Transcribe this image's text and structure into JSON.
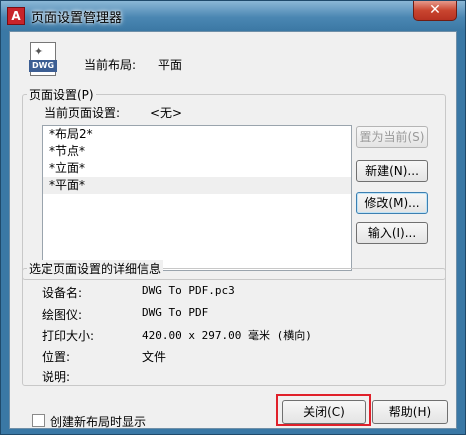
{
  "window": {
    "title": "页面设置管理器",
    "app_icon_letter": "A",
    "close_glyph": "✕"
  },
  "header": {
    "icon_label": "DWG",
    "current_layout_label": "当前布局:",
    "current_layout_value": "平面"
  },
  "page_setup": {
    "group_title": "页面设置(P)",
    "current_label": "当前页面设置:",
    "current_value": "<无>",
    "items": [
      "*布局2*",
      "*节点*",
      "*立面*",
      "*平面*"
    ],
    "selected_index": 3,
    "buttons": {
      "set_current": "置为当前(S)",
      "new": "新建(N)...",
      "modify": "修改(M)...",
      "import": "输入(I)..."
    }
  },
  "details": {
    "group_title": "选定页面设置的详细信息",
    "device_label": "设备名:",
    "device_value": "DWG To PDF.pc3",
    "plotter_label": "绘图仪:",
    "plotter_value": "DWG To PDF",
    "size_label": "打印大小:",
    "size_value": "420.00 x 297.00 毫米 (横向)",
    "location_label": "位置:",
    "location_value": "文件",
    "description_label": "说明:"
  },
  "footer": {
    "checkbox_label": "创建新布局时显示",
    "checkbox_checked": false,
    "close_button": "关闭(C)",
    "help_button": "帮助(H)"
  }
}
